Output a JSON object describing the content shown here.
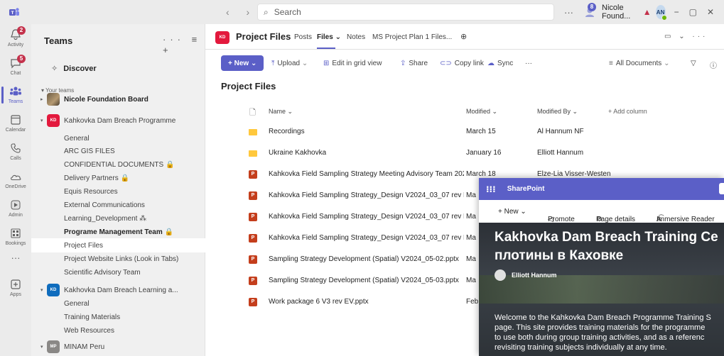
{
  "titlebar": {
    "nav": "‹ ›",
    "search_placeholder": "Search",
    "more": "···",
    "notification_count": "8",
    "username": "Nicole Found...",
    "warning": "▲",
    "avatar_initials": "AN",
    "minimize": "−",
    "restore": "▢",
    "close": "✕"
  },
  "rail": {
    "items": [
      {
        "label": "Activity",
        "badge": "2"
      },
      {
        "label": "Chat",
        "badge": "5"
      },
      {
        "label": "Teams"
      },
      {
        "label": "Calendar"
      },
      {
        "label": "Calls"
      },
      {
        "label": "OneDrive"
      },
      {
        "label": "Admin"
      },
      {
        "label": "Bookings"
      },
      {
        "label": "···"
      },
      {
        "label": "Apps"
      }
    ],
    "accent": "#5b5fc7"
  },
  "teams_pane": {
    "title": "Teams",
    "icons": "··· ≡ +",
    "discover": "Discover",
    "section": "Your teams",
    "rows": [
      {
        "type": "team",
        "name": "Nicole Foundation Board",
        "bold": true,
        "caret": "▸"
      },
      {
        "type": "team",
        "name": "Kahkovka Dam Breach Programme",
        "avatar": "KD",
        "color": "#e3193d",
        "caret": "▾"
      },
      {
        "type": "channel",
        "name": "General"
      },
      {
        "type": "channel",
        "name": "ARC GIS FILES"
      },
      {
        "type": "channel",
        "name": "CONFIDENTIAL DOCUMENTS 🔒"
      },
      {
        "type": "channel",
        "name": "Delivery Partners 🔒"
      },
      {
        "type": "channel",
        "name": "Equis Resources"
      },
      {
        "type": "channel",
        "name": "External Communications"
      },
      {
        "type": "channel",
        "name": "Learning_Development ⁂"
      },
      {
        "type": "channel",
        "name": "Programe Management Team 🔒",
        "bold": true
      },
      {
        "type": "channel",
        "name": "Project Files",
        "selected": true
      },
      {
        "type": "channel",
        "name": "Project Website Links (Look in Tabs)"
      },
      {
        "type": "channel",
        "name": "Scientific Advisory Team"
      },
      {
        "type": "team",
        "name": "Kakhovka Dam Breach Learning a...",
        "avatar": "KD",
        "color": "#0f6cbd",
        "caret": "▾"
      },
      {
        "type": "channel",
        "name": "General"
      },
      {
        "type": "channel",
        "name": "Training Materials"
      },
      {
        "type": "channel",
        "name": "Web Resources"
      },
      {
        "type": "team",
        "name": "MINAM Peru",
        "avatar": "MP",
        "color": "#8a8886",
        "caret": "▾"
      }
    ]
  },
  "channel": {
    "avatar": "KD",
    "title": "Project Files",
    "tabs": [
      {
        "label": "Posts"
      },
      {
        "label": "Files ⌄",
        "active": true
      },
      {
        "label": "Notes"
      },
      {
        "label": "MS Project Plan 1 Files..."
      },
      {
        "label": "⊕"
      }
    ],
    "right_icons": "▭ ⌄ ···"
  },
  "command_bar": {
    "new_label": "+ New ⌄",
    "upload": "Upload",
    "edit_grid": "Edit in grid view",
    "share": "Share",
    "copy_link": "Copy link",
    "sync": "Sync",
    "more": "···",
    "view": "All Documents",
    "filter": "▽",
    "info": "ⓘ"
  },
  "library": {
    "title": "Project Files",
    "columns": {
      "name": "Name ⌄",
      "modified": "Modified ⌄",
      "modified_by": "Modified By ⌄",
      "add": "+ Add column"
    },
    "rows": [
      {
        "type": "folder",
        "name": "Recordings",
        "modified": "March 15",
        "by": "Al Hannum NF"
      },
      {
        "type": "folder",
        "name": "Ukraine Kakhovka",
        "modified": "January 16",
        "by": "Elliott Hannum"
      },
      {
        "type": "ppt",
        "name": "Kahkovka Field Sampling Strategy Meeting Advisory Team 202...",
        "modified": "March 18",
        "by": "Elze-Lia Visser-Westen"
      },
      {
        "type": "ppt",
        "name": "Kahkovka Field Sampling Strategy_Design V2024_03_07 rev EV....",
        "modified": "Ma",
        "by": ""
      },
      {
        "type": "ppt",
        "name": "Kahkovka Field Sampling Strategy_Design V2024_03_07 rev EV....",
        "modified": "Ma",
        "by": ""
      },
      {
        "type": "ppt",
        "name": "Kahkovka Field Sampling Strategy_Design V2024_03_07 rev EV....",
        "modified": "Ma",
        "by": ""
      },
      {
        "type": "ppt",
        "name": "Sampling Strategy Development (Spatial) V2024_05-02.pptx",
        "modified": "Ma",
        "by": ""
      },
      {
        "type": "ppt",
        "name": "Sampling Strategy Development (Spatial) V2024_05-03.pptx",
        "modified": "Ma",
        "by": ""
      },
      {
        "type": "ppt",
        "name": "Work package 6 V3 rev EV.pptx",
        "modified": "Feb",
        "by": ""
      }
    ]
  },
  "sharepoint": {
    "brand": "SharePoint",
    "waffle": "⁝⁝⁝",
    "new": "+ New ⌄",
    "promote": "Promote",
    "page_details": "Page details",
    "immersive": "Immersive Reader",
    "hero_title_line1": "Kakhovka Dam Breach Training Ce",
    "hero_title_line2": "плотины в Каховке",
    "author": "Elliott Hannum",
    "welcome": [
      "Welcome to the Kahkovka Dam Breach Programme Training S",
      "page. This site provides training materials for the programme",
      "to use both during group training activities, and as a referenc",
      "revisiting training subjects individually at any time."
    ]
  }
}
